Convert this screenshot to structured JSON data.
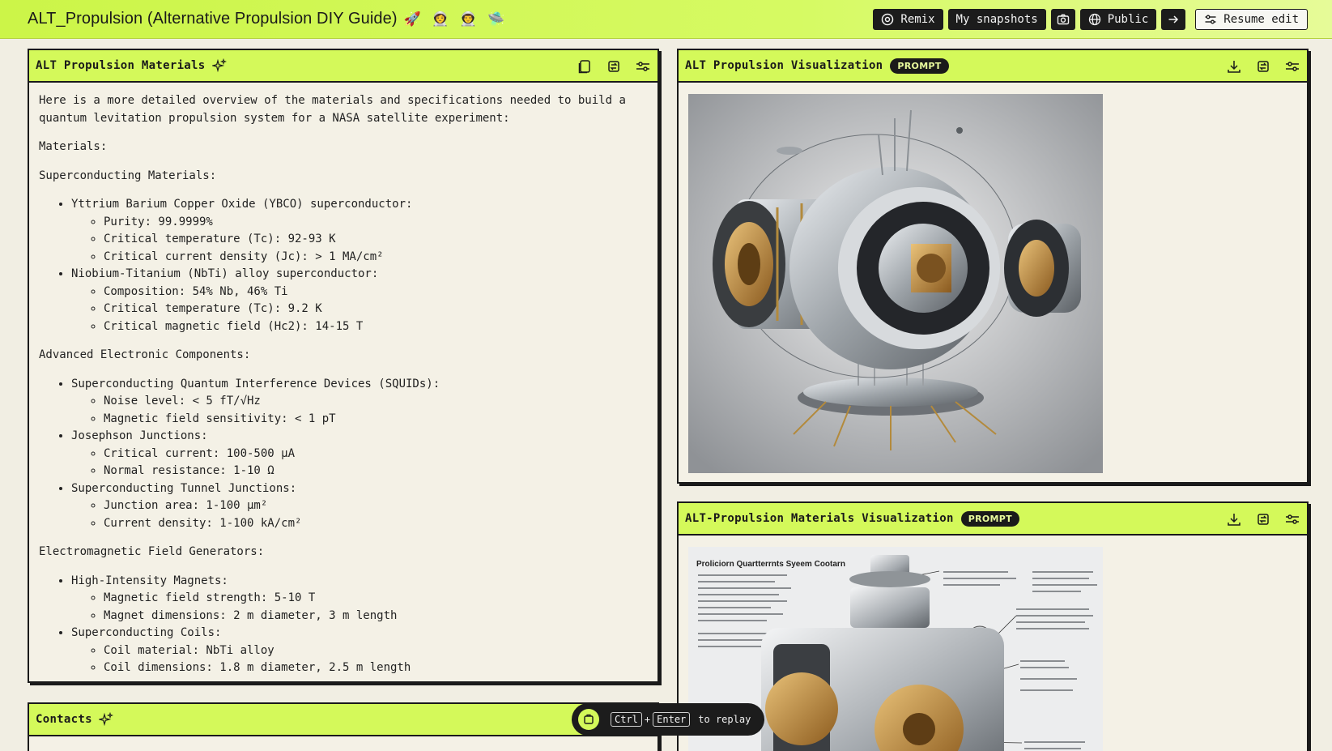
{
  "app": {
    "title": "ALT_Propulsion (Alternative Propulsion DIY Guide)",
    "emojis": "🚀 👩‍🚀 👨‍🚀 🛸"
  },
  "toolbar": {
    "remix_label": "Remix",
    "snapshots_label": "My snapshots",
    "visibility_label": "Public",
    "resume_label": "Resume edit"
  },
  "materials_panel": {
    "title": "ALT Propulsion Materials",
    "intro": "Here is a more detailed overview of the materials and specifications needed to build a quantum levitation propulsion system for a NASA satellite experiment:",
    "sections": [
      {
        "heading": "Materials:",
        "items": []
      },
      {
        "heading": "Superconducting Materials:",
        "items": [
          {
            "label": "Yttrium Barium Copper Oxide (YBCO) superconductor:",
            "specs": [
              "Purity: 99.9999%",
              "Critical temperature (Tc): 92-93 K",
              "Critical current density (Jc): > 1 MA/cm²"
            ]
          },
          {
            "label": "Niobium-Titanium (NbTi) alloy superconductor:",
            "specs": [
              "Composition: 54% Nb, 46% Ti",
              "Critical temperature (Tc): 9.2 K",
              "Critical magnetic field (Hc2): 14-15 T"
            ]
          }
        ]
      },
      {
        "heading": "Advanced Electronic Components:",
        "items": [
          {
            "label": "Superconducting Quantum Interference Devices (SQUIDs):",
            "specs": [
              "Noise level: < 5 fT/√Hz",
              "Magnetic field sensitivity: < 1 pT"
            ]
          },
          {
            "label": "Josephson Junctions:",
            "specs": [
              "Critical current: 100-500 μA",
              "Normal resistance: 1-10 Ω"
            ]
          },
          {
            "label": "Superconducting Tunnel Junctions:",
            "specs": [
              "Junction area: 1-100 μm²",
              "Current density: 1-100 kA/cm²"
            ]
          }
        ]
      },
      {
        "heading": "Electromagnetic Field Generators:",
        "items": [
          {
            "label": "High-Intensity Magnets:",
            "specs": [
              "Magnetic field strength: 5-10 T",
              "Magnet dimensions: 2 m diameter, 3 m length"
            ]
          },
          {
            "label": "Superconducting Coils:",
            "specs": [
              "Coil material: NbTi alloy",
              "Coil dimensions: 1.8 m diameter, 2.5 m length"
            ]
          }
        ]
      }
    ]
  },
  "visualization_panel": {
    "title": "ALT Propulsion Visualization",
    "badge": "PROMPT"
  },
  "materials_visualization_panel": {
    "title": "ALT-Propulsion Materials Visualization",
    "badge": "PROMPT",
    "diagram_heading": "Proliciorn Quartterrnts Syeem Cootarn"
  },
  "contacts_panel": {
    "title": "Contacts"
  },
  "replay_hint": {
    "key1": "Ctrl",
    "plus": "+",
    "key2": "Enter",
    "text": "to replay"
  }
}
